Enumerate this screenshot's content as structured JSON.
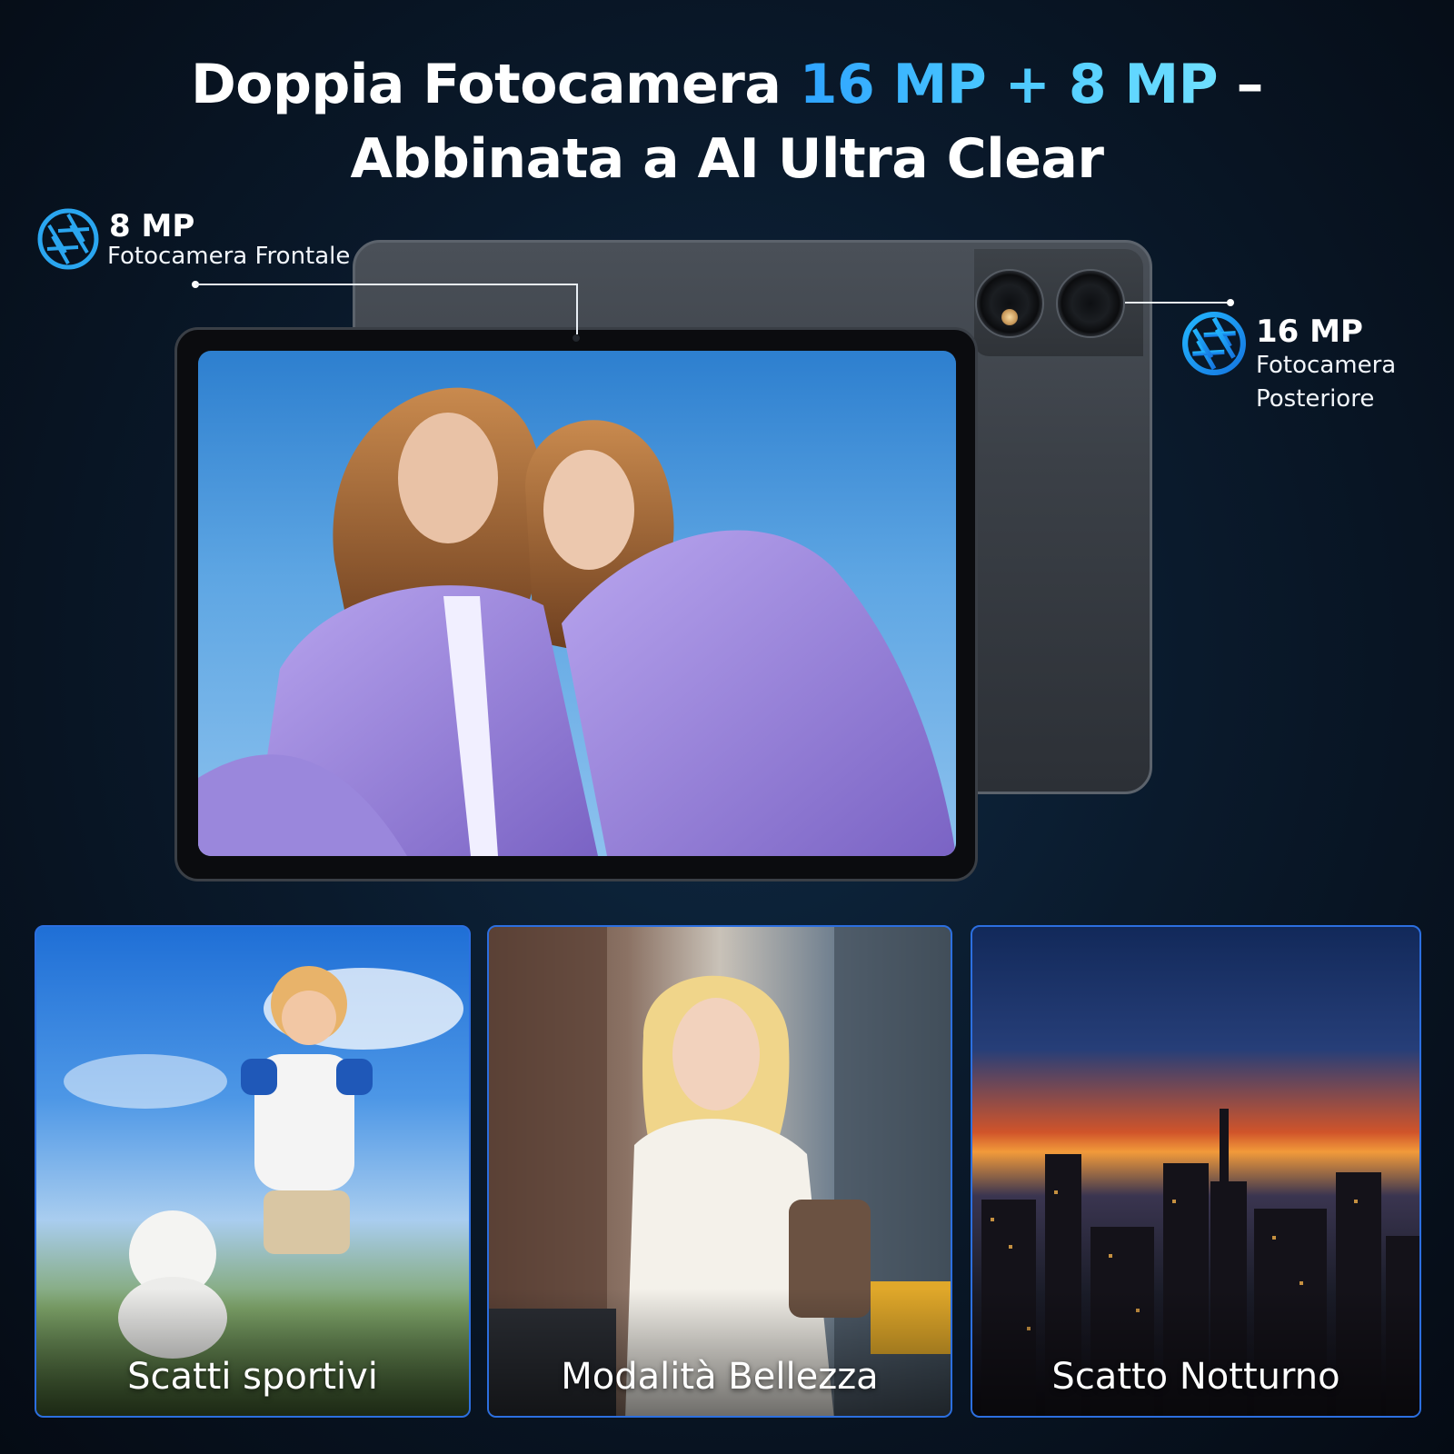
{
  "title": {
    "line1_prefix": "Doppia Fotocamera ",
    "line1_accent": "16 MP + 8 MP",
    "line1_suffix": " –",
    "line2": "Abbinata a AI Ultra Clear"
  },
  "front_camera": {
    "mp": "8 MP",
    "label": "Fotocamera Frontale",
    "icon": "camera-aperture-icon"
  },
  "rear_camera": {
    "mp": "16 MP",
    "label": "Fotocamera Posteriore",
    "icon": "camera-aperture-icon"
  },
  "panels": [
    {
      "caption": "Scatti sportivi"
    },
    {
      "caption": "Modalità Bellezza"
    },
    {
      "caption": "Scatto Notturno"
    }
  ],
  "colors": {
    "accent": "#2ea3ff",
    "panel_border": "#2c6fe0",
    "background": "#0a1a2c"
  }
}
